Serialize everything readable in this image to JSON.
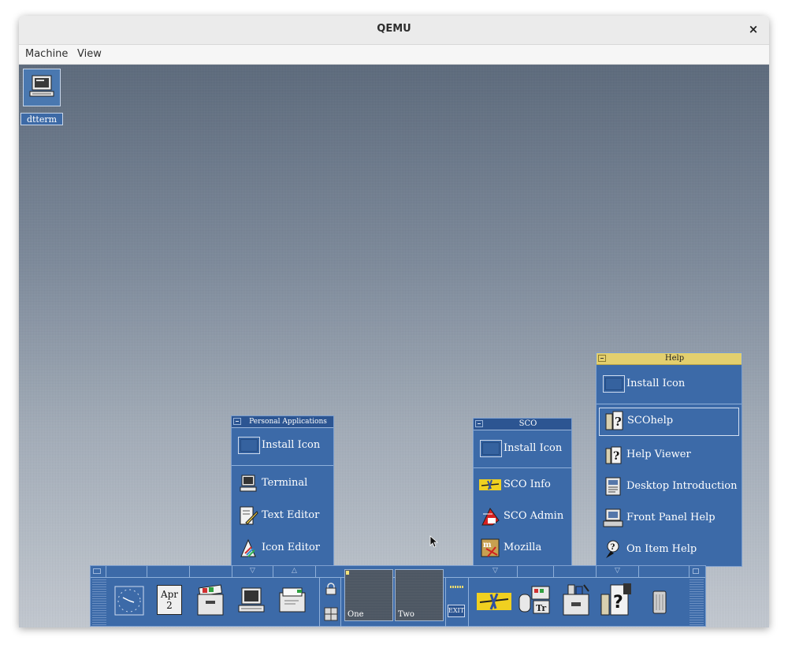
{
  "window": {
    "title": "QEMU",
    "close_glyph": "×"
  },
  "menu": {
    "machine": "Machine",
    "view": "View"
  },
  "desktop": {
    "icon_label": "dtterm",
    "icon": "terminal-icon"
  },
  "panels": {
    "personal": {
      "title": "Personal Applications",
      "install": "Install Icon",
      "items": [
        "Terminal",
        "Text Editor",
        "Icon Editor"
      ]
    },
    "sco": {
      "title": "SCO",
      "install": "Install Icon",
      "items": [
        "SCO Info",
        "SCO Admin",
        "Mozilla"
      ]
    },
    "help": {
      "title": "Help",
      "install": "Install Icon",
      "items": [
        "SCOhelp",
        "Help Viewer",
        "Desktop Introduction",
        "Front Panel Help",
        "On Item Help"
      ]
    }
  },
  "front_panel": {
    "calendar_month": "Apr",
    "calendar_day": "2",
    "workspace_one": "One",
    "workspace_two": "Two",
    "exit_label": "EXIT",
    "arrow_down": "▽",
    "arrow_up": "△"
  },
  "colors": {
    "panel": "#3c6aa8",
    "active_title": "#e3cf6e",
    "desktop_top": "#5c6a7c"
  }
}
